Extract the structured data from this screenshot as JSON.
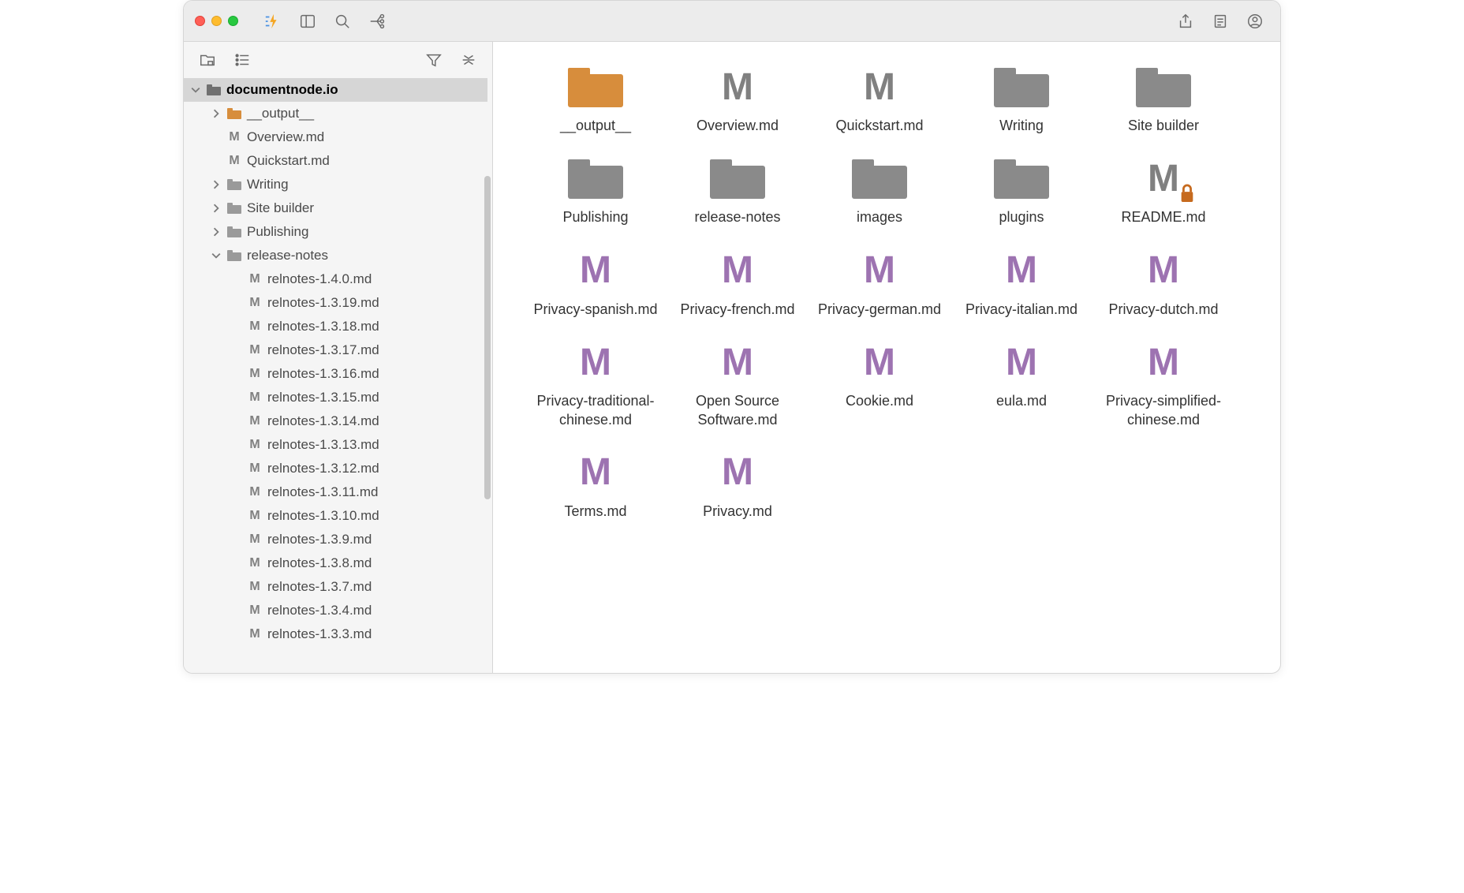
{
  "titlebar": {},
  "sidebar": {
    "tree": [
      {
        "depth": 0,
        "chev": "down",
        "icon": "folder-dark",
        "label": "documentnode.io",
        "selected": true
      },
      {
        "depth": 1,
        "chev": "right",
        "icon": "folder-orange",
        "label": "__output__"
      },
      {
        "depth": 1,
        "chev": "none",
        "icon": "md",
        "label": "Overview.md"
      },
      {
        "depth": 1,
        "chev": "none",
        "icon": "md",
        "label": "Quickstart.md"
      },
      {
        "depth": 1,
        "chev": "right",
        "icon": "folder-gray",
        "label": "Writing"
      },
      {
        "depth": 1,
        "chev": "right",
        "icon": "folder-gray",
        "label": "Site builder"
      },
      {
        "depth": 1,
        "chev": "right",
        "icon": "folder-gray",
        "label": "Publishing"
      },
      {
        "depth": 1,
        "chev": "down",
        "icon": "folder-gray",
        "label": "release-notes"
      },
      {
        "depth": 2,
        "chev": "none",
        "icon": "md",
        "label": "relnotes-1.4.0.md"
      },
      {
        "depth": 2,
        "chev": "none",
        "icon": "md",
        "label": "relnotes-1.3.19.md"
      },
      {
        "depth": 2,
        "chev": "none",
        "icon": "md",
        "label": "relnotes-1.3.18.md"
      },
      {
        "depth": 2,
        "chev": "none",
        "icon": "md",
        "label": "relnotes-1.3.17.md"
      },
      {
        "depth": 2,
        "chev": "none",
        "icon": "md",
        "label": "relnotes-1.3.16.md"
      },
      {
        "depth": 2,
        "chev": "none",
        "icon": "md",
        "label": "relnotes-1.3.15.md"
      },
      {
        "depth": 2,
        "chev": "none",
        "icon": "md",
        "label": "relnotes-1.3.14.md"
      },
      {
        "depth": 2,
        "chev": "none",
        "icon": "md",
        "label": "relnotes-1.3.13.md"
      },
      {
        "depth": 2,
        "chev": "none",
        "icon": "md",
        "label": "relnotes-1.3.12.md"
      },
      {
        "depth": 2,
        "chev": "none",
        "icon": "md",
        "label": "relnotes-1.3.11.md"
      },
      {
        "depth": 2,
        "chev": "none",
        "icon": "md",
        "label": "relnotes-1.3.10.md"
      },
      {
        "depth": 2,
        "chev": "none",
        "icon": "md",
        "label": "relnotes-1.3.9.md"
      },
      {
        "depth": 2,
        "chev": "none",
        "icon": "md",
        "label": "relnotes-1.3.8.md"
      },
      {
        "depth": 2,
        "chev": "none",
        "icon": "md",
        "label": "relnotes-1.3.7.md"
      },
      {
        "depth": 2,
        "chev": "none",
        "icon": "md",
        "label": "relnotes-1.3.4.md"
      },
      {
        "depth": 2,
        "chev": "none",
        "icon": "md",
        "label": "relnotes-1.3.3.md"
      }
    ]
  },
  "grid": {
    "items": [
      {
        "name": "__output__",
        "type": "folder-orange"
      },
      {
        "name": "Overview.md",
        "type": "md-gray"
      },
      {
        "name": "Quickstart.md",
        "type": "md-gray"
      },
      {
        "name": "Writing",
        "type": "folder-gray"
      },
      {
        "name": "Site builder",
        "type": "folder-gray"
      },
      {
        "name": "Publishing",
        "type": "folder-gray"
      },
      {
        "name": "release-notes",
        "type": "folder-gray"
      },
      {
        "name": "images",
        "type": "folder-gray"
      },
      {
        "name": "plugins",
        "type": "folder-gray"
      },
      {
        "name": "README.md",
        "type": "md-gray-locked"
      },
      {
        "name": "Privacy-spanish.md",
        "type": "md-purple"
      },
      {
        "name": "Privacy-french.md",
        "type": "md-purple"
      },
      {
        "name": "Privacy-german.md",
        "type": "md-purple"
      },
      {
        "name": "Privacy-italian.md",
        "type": "md-purple"
      },
      {
        "name": "Privacy-dutch.md",
        "type": "md-purple"
      },
      {
        "name": "Privacy-traditional-chinese.md",
        "type": "md-purple"
      },
      {
        "name": "Open Source Software.md",
        "type": "md-purple"
      },
      {
        "name": "Cookie.md",
        "type": "md-purple"
      },
      {
        "name": "eula.md",
        "type": "md-purple"
      },
      {
        "name": "Privacy-simplified-chinese.md",
        "type": "md-purple"
      },
      {
        "name": "Terms.md",
        "type": "md-purple"
      },
      {
        "name": "Privacy.md",
        "type": "md-purple"
      }
    ]
  }
}
